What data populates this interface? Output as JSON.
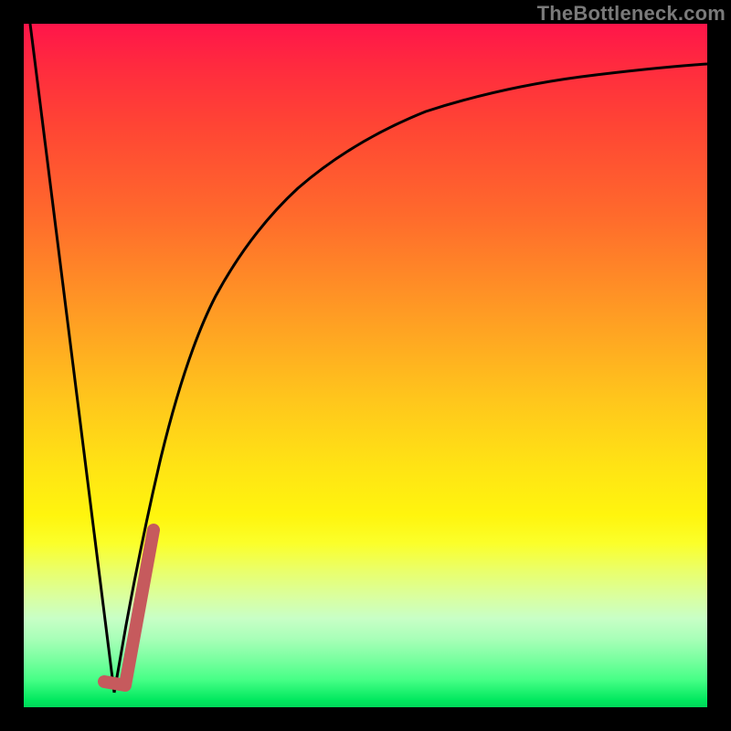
{
  "watermark": "TheBottleneck.com",
  "chart_data": {
    "type": "line",
    "title": "",
    "xlabel": "",
    "ylabel": "",
    "xlim_rel": [
      0,
      1
    ],
    "ylim_rel": [
      0,
      1
    ],
    "note": "Axes are unitless; values are relative 0–1 positions inferred from pixels.",
    "series": [
      {
        "name": "left-falling-line",
        "x": [
          0.01,
          0.132
        ],
        "y": [
          1.0,
          0.022
        ]
      },
      {
        "name": "rising-curve",
        "x": [
          0.132,
          0.15,
          0.17,
          0.2,
          0.235,
          0.28,
          0.33,
          0.4,
          0.48,
          0.57,
          0.66,
          0.76,
          0.87,
          1.0
        ],
        "y": [
          0.022,
          0.12,
          0.23,
          0.365,
          0.48,
          0.58,
          0.66,
          0.74,
          0.795,
          0.838,
          0.87,
          0.895,
          0.913,
          0.928
        ]
      },
      {
        "name": "highlight-J-overlay",
        "x": [
          0.118,
          0.148,
          0.19
        ],
        "y": [
          0.038,
          0.032,
          0.26
        ]
      }
    ],
    "gradient_stops_bottom_to_top": [
      {
        "pos": 0.0,
        "color": "#00d85a"
      },
      {
        "pos": 0.04,
        "color": "#46ff86"
      },
      {
        "pos": 0.1,
        "color": "#a8ffb8"
      },
      {
        "pos": 0.16,
        "color": "#d9ffa2"
      },
      {
        "pos": 0.24,
        "color": "#fbff2a"
      },
      {
        "pos": 0.35,
        "color": "#ffe414"
      },
      {
        "pos": 0.5,
        "color": "#ffb81e"
      },
      {
        "pos": 0.72,
        "color": "#ff6a2c"
      },
      {
        "pos": 0.88,
        "color": "#ff3a38"
      },
      {
        "pos": 1.0,
        "color": "#ff154a"
      }
    ]
  }
}
